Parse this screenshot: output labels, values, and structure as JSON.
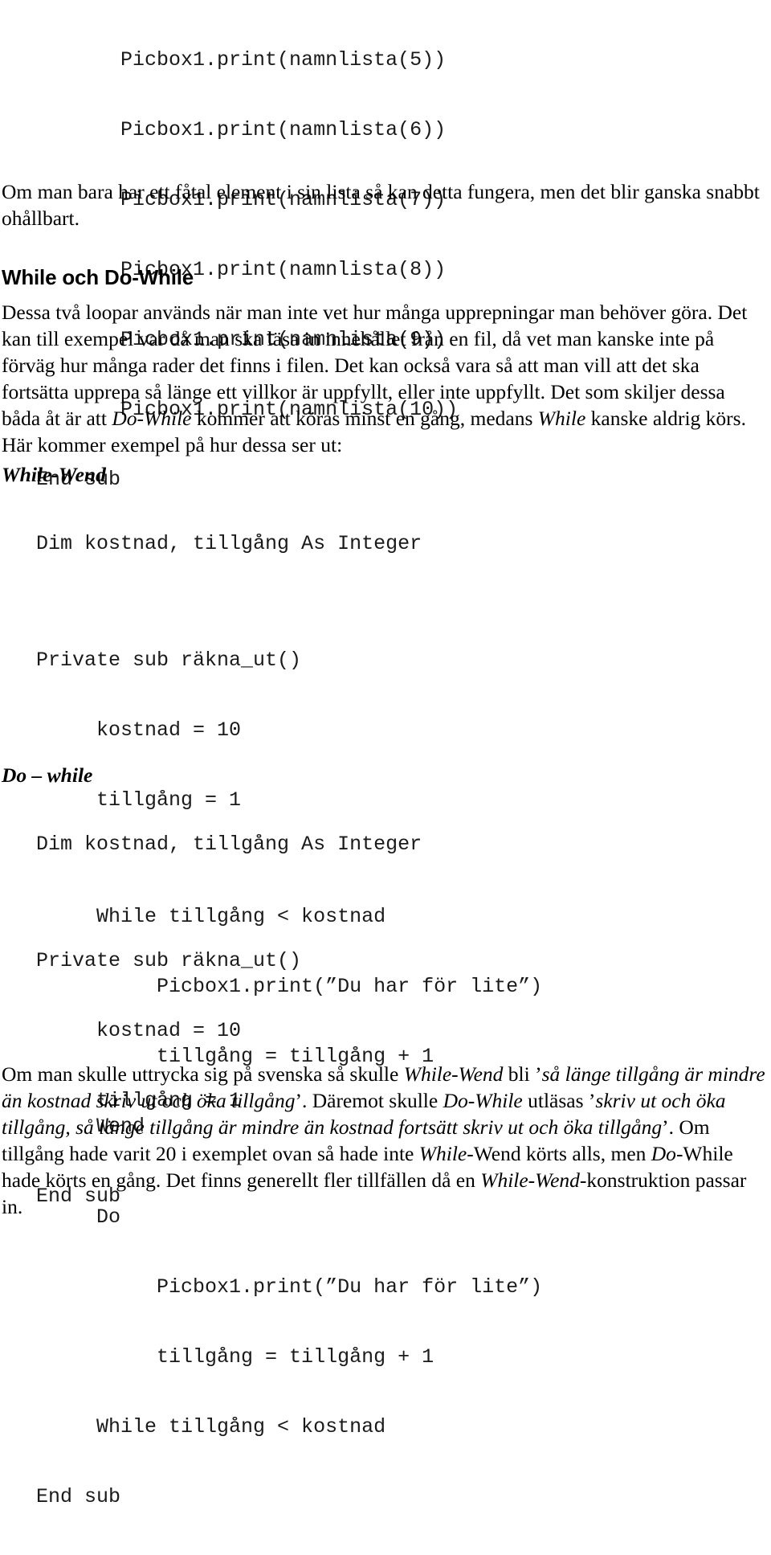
{
  "document": {
    "language": "sv",
    "text_color": "#000000",
    "background_color": "#ffffff"
  },
  "top_code_block": {
    "name": "namnlista-print-listing",
    "lines": [
      "          Picbox1.print(namnlista(5))",
      "          Picbox1.print(namnlista(6))",
      "          Picbox1.print(namnlista(7))",
      "          Picbox1.print(namnlista(8))",
      "          Picbox1.print(namnlista(9))",
      "          Picbox1.print(namnlista(10))",
      "   End sub"
    ]
  },
  "intro_paragraph": {
    "text": "Om man bara har ett fåtal element i sin lista så kan detta fungera, men det blir ganska snabbt ohållbart."
  },
  "heading": {
    "text": "While och Do-While"
  },
  "explain_paragraph": {
    "part1": "Dessa två loopar används när man inte vet hur många upprepningar man behöver göra. Det kan till exempel var då man ska läsa in innehållet från en fil, då vet man kanske inte på förväg hur många rader det finns i filen. Det kan också vara så att man vill att det ska fortsätta upprepa så länge ett villkor är uppfyllt, eller inte uppfyllt. Det som skiljer dessa båda åt är att ",
    "em1": "Do-While",
    "part2": " kommer att köras minst en gång, medans ",
    "em2": "While",
    "part3": " kanske aldrig körs. Här kommer exempel på hur dessa ser ut:"
  },
  "while_wend_section": {
    "label": "While-Wend",
    "code_lines": [
      "   Dim kostnad, tillgång As Integer",
      "",
      "   Private sub räkna_ut()",
      "        kostnad = 10",
      "        tillgång = 1",
      "",
      "        While tillgång < kostnad",
      "             Picbox1.print(”Du har för lite”)",
      "             tillgång = tillgång + 1",
      "        Wend",
      "   End sub"
    ]
  },
  "do_while_section": {
    "label": "Do – while",
    "code_lines": [
      "   Dim kostnad, tillgång As Integer",
      "",
      "   Private sub räkna_ut()",
      "        kostnad = 10",
      "        tillgång = 1",
      "",
      "        Do",
      "             Picbox1.print(”Du har för lite”)",
      "             tillgång = tillgång + 1",
      "        While tillgång < kostnad",
      "   End sub"
    ]
  },
  "final_paragraph": {
    "p1": "Om man skulle uttrycka sig på svenska så skulle ",
    "em1": "While-Wend",
    "p2": " bli ’",
    "em2": "så länge tillgång är mindre än kostnad skriv ut och öka tillgång",
    "p3": "’. Däremot skulle ",
    "em3": "Do-While",
    "p4": " utläsas ’",
    "em4": "skriv ut och öka tillgång, så länge tillgång är mindre än kostnad fortsätt skriv ut och öka tillgång",
    "p5": "’. Om tillgång hade varit 20 i exemplet ovan så hade inte ",
    "em5": "While",
    "p6": "-Wend körts alls, men ",
    "em6": "Do",
    "p7": "-While hade körts en gång. Det finns generellt fler tillfällen då en ",
    "em7": "While-Wend",
    "p8": "-konstruktion passar in."
  }
}
